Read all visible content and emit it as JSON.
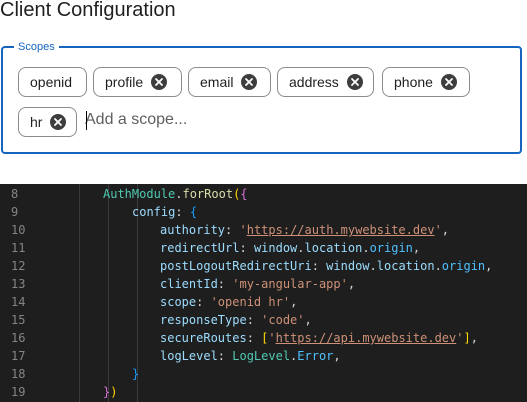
{
  "page": {
    "title": "Client Configuration"
  },
  "scopes": {
    "legend": "Scopes",
    "chips": [
      {
        "label": "openid",
        "removable": false
      },
      {
        "label": "profile",
        "removable": true
      },
      {
        "label": "email",
        "removable": true
      },
      {
        "label": "address",
        "removable": true
      },
      {
        "label": "phone",
        "removable": true
      },
      {
        "label": "hr",
        "removable": true
      }
    ],
    "input": {
      "value": "",
      "placeholder": "Add a scope..."
    },
    "accent_color": "#1565c0"
  },
  "code_editor": {
    "lines": [
      {
        "number": "8",
        "tokens": [
          [
            "AuthModule",
            "t-fn"
          ],
          [
            ".",
            "t-punc"
          ],
          [
            "forRoot",
            "t-call"
          ],
          [
            "(",
            "t-brace"
          ],
          [
            "{",
            "t-brace2"
          ]
        ]
      },
      {
        "number": "9",
        "tokens": [
          [
            "config",
            "t-key"
          ],
          [
            ": ",
            "t-punc"
          ],
          [
            "{",
            "t-brace3"
          ]
        ]
      },
      {
        "number": "10",
        "tokens": [
          [
            "authority",
            "t-key"
          ],
          [
            ": ",
            "t-punc"
          ],
          [
            "'",
            "t-str"
          ],
          [
            "https://auth.mywebsite.dev",
            "t-url"
          ],
          [
            "'",
            "t-str"
          ],
          [
            ",",
            "t-punc"
          ]
        ]
      },
      {
        "number": "11",
        "tokens": [
          [
            "redirectUrl",
            "t-key"
          ],
          [
            ": ",
            "t-punc"
          ],
          [
            "window",
            "t-var"
          ],
          [
            ".",
            "t-punc"
          ],
          [
            "location",
            "t-var"
          ],
          [
            ".",
            "t-punc"
          ],
          [
            "origin",
            "t-prop"
          ],
          [
            ",",
            "t-punc"
          ]
        ]
      },
      {
        "number": "12",
        "tokens": [
          [
            "postLogoutRedirectUri",
            "t-key"
          ],
          [
            ": ",
            "t-punc"
          ],
          [
            "window",
            "t-var"
          ],
          [
            ".",
            "t-punc"
          ],
          [
            "location",
            "t-var"
          ],
          [
            ".",
            "t-punc"
          ],
          [
            "origin",
            "t-prop"
          ],
          [
            ",",
            "t-punc"
          ]
        ]
      },
      {
        "number": "13",
        "tokens": [
          [
            "clientId",
            "t-key"
          ],
          [
            ": ",
            "t-punc"
          ],
          [
            "'my-angular-app'",
            "t-str"
          ],
          [
            ",",
            "t-punc"
          ]
        ]
      },
      {
        "number": "14",
        "tokens": [
          [
            "scope",
            "t-key"
          ],
          [
            ": ",
            "t-punc"
          ],
          [
            "'openid hr'",
            "t-str"
          ],
          [
            ",",
            "t-punc"
          ]
        ]
      },
      {
        "number": "15",
        "tokens": [
          [
            "responseType",
            "t-key"
          ],
          [
            ": ",
            "t-punc"
          ],
          [
            "'code'",
            "t-str"
          ],
          [
            ",",
            "t-punc"
          ]
        ]
      },
      {
        "number": "16",
        "tokens": [
          [
            "secureRoutes",
            "t-key"
          ],
          [
            ": ",
            "t-punc"
          ],
          [
            "[",
            "t-brace"
          ],
          [
            "'",
            "t-str"
          ],
          [
            "https://api.mywebsite.dev",
            "t-url"
          ],
          [
            "'",
            "t-str"
          ],
          [
            "]",
            "t-brace"
          ],
          [
            ",",
            "t-punc"
          ]
        ]
      },
      {
        "number": "17",
        "tokens": [
          [
            "logLevel",
            "t-key"
          ],
          [
            ": ",
            "t-punc"
          ],
          [
            "LogLevel",
            "t-fn"
          ],
          [
            ".",
            "t-punc"
          ],
          [
            "Error",
            "t-prop"
          ],
          [
            ",",
            "t-punc"
          ]
        ]
      },
      {
        "number": "18",
        "tokens": [
          [
            "}",
            "t-brace3"
          ]
        ]
      },
      {
        "number": "19",
        "tokens": [
          [
            "}",
            "t-brace2"
          ],
          [
            ")",
            "t-brace"
          ]
        ]
      }
    ]
  }
}
